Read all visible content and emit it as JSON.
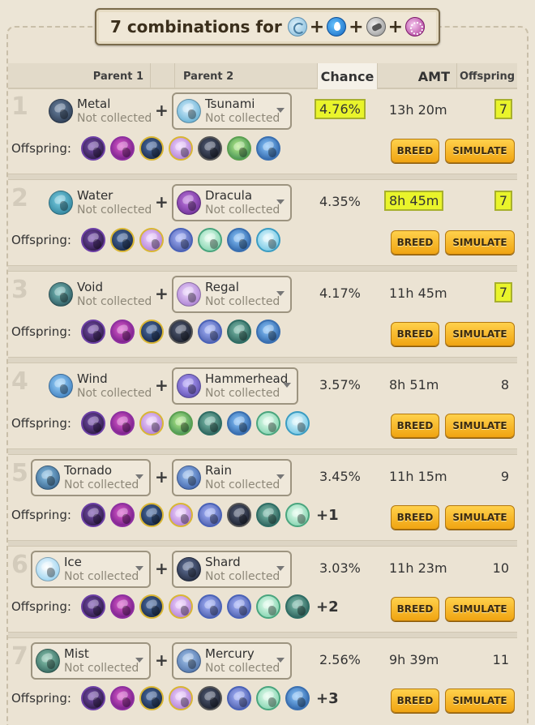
{
  "title": {
    "text": "7 combinations for",
    "elements": [
      "wind-element-icon",
      "water-element-icon",
      "metal-element-icon",
      "void-element-icon"
    ]
  },
  "header": {
    "parent1": "Parent 1",
    "parent2": "Parent 2",
    "chance": "Chance",
    "amt": "AMT",
    "offspring": "Offspring"
  },
  "labels": {
    "offspring": "Offspring:",
    "breed": "BREED",
    "simulate": "SIMULATE"
  },
  "rows": [
    {
      "rank": "1",
      "parent1": {
        "name": "Metal",
        "status": "Not collected",
        "color": "metal",
        "dropdown": false
      },
      "parent2": {
        "name": "Tsunami",
        "status": "Not collected",
        "color": "tsu",
        "dropdown": true
      },
      "chance": "4.76%",
      "chance_highlight": true,
      "amt": "13h 20m",
      "amt_highlight": false,
      "offspring": "7",
      "offspring_highlight": true,
      "offspring_icons": [
        "black",
        "purple",
        "navy",
        "lilac",
        "dark",
        "green",
        "blue"
      ],
      "more": ""
    },
    {
      "rank": "2",
      "parent1": {
        "name": "Water",
        "status": "Not collected",
        "color": "water",
        "dropdown": false
      },
      "parent2": {
        "name": "Dracula",
        "status": "Not collected",
        "color": "dracula",
        "dropdown": true
      },
      "chance": "4.35%",
      "chance_highlight": false,
      "amt": "8h 45m",
      "amt_highlight": true,
      "offspring": "7",
      "offspring_highlight": true,
      "offspring_icons": [
        "black",
        "navy",
        "lilac",
        "slate",
        "mint",
        "blue",
        "cyan"
      ],
      "more": ""
    },
    {
      "rank": "3",
      "parent1": {
        "name": "Void",
        "status": "Not collected",
        "color": "void",
        "dropdown": false
      },
      "parent2": {
        "name": "Regal",
        "status": "Not collected",
        "color": "regal",
        "dropdown": true
      },
      "chance": "4.17%",
      "chance_highlight": false,
      "amt": "11h 45m",
      "amt_highlight": false,
      "offspring": "7",
      "offspring_highlight": true,
      "offspring_icons": [
        "black",
        "purple",
        "navy",
        "dark",
        "slate",
        "teal",
        "blue"
      ],
      "more": ""
    },
    {
      "rank": "4",
      "parent1": {
        "name": "Wind",
        "status": "Not collected",
        "color": "wind",
        "dropdown": false
      },
      "parent2": {
        "name": "Hammerhead",
        "status": "Not collected",
        "color": "hammer",
        "dropdown": true
      },
      "chance": "3.57%",
      "chance_highlight": false,
      "amt": "8h 51m",
      "amt_highlight": false,
      "offspring": "8",
      "offspring_highlight": false,
      "offspring_icons": [
        "black",
        "purple",
        "lilac",
        "green",
        "teal",
        "blue",
        "mint",
        "cyan"
      ],
      "more": ""
    },
    {
      "rank": "5",
      "parent1": {
        "name": "Tornado",
        "status": "Not collected",
        "color": "tornado",
        "dropdown": true
      },
      "parent2": {
        "name": "Rain",
        "status": "Not collected",
        "color": "rain",
        "dropdown": true
      },
      "chance": "3.45%",
      "chance_highlight": false,
      "amt": "11h 15m",
      "amt_highlight": false,
      "offspring": "9",
      "offspring_highlight": false,
      "offspring_icons": [
        "black",
        "purple",
        "navy",
        "lilac",
        "slate",
        "dark",
        "teal",
        "mint"
      ],
      "more": "+1"
    },
    {
      "rank": "6",
      "parent1": {
        "name": "Ice",
        "status": "Not collected",
        "color": "ice",
        "dropdown": true
      },
      "parent2": {
        "name": "Shard",
        "status": "Not collected",
        "color": "shard",
        "dropdown": true
      },
      "chance": "3.03%",
      "chance_highlight": false,
      "amt": "11h 23m",
      "amt_highlight": false,
      "offspring": "10",
      "offspring_highlight": false,
      "offspring_icons": [
        "black",
        "purple",
        "navy",
        "lilac",
        "slate",
        "slate",
        "mint",
        "teal"
      ],
      "more": "+2"
    },
    {
      "rank": "7",
      "parent1": {
        "name": "Mist",
        "status": "Not collected",
        "color": "mist",
        "dropdown": true
      },
      "parent2": {
        "name": "Mercury",
        "status": "Not collected",
        "color": "mercury",
        "dropdown": true
      },
      "chance": "2.56%",
      "chance_highlight": false,
      "amt": "9h 39m",
      "amt_highlight": false,
      "offspring": "11",
      "offspring_highlight": false,
      "offspring_icons": [
        "black",
        "purple",
        "navy",
        "lilac",
        "dark",
        "slate",
        "mint",
        "blue"
      ],
      "more": "+3"
    }
  ]
}
